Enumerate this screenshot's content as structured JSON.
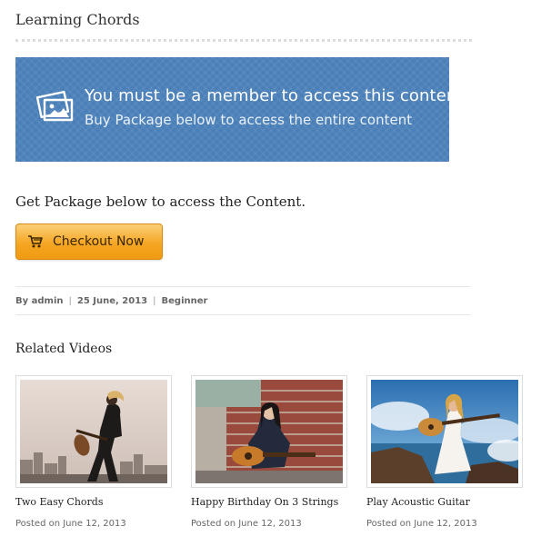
{
  "page": {
    "title": "Learning Chords"
  },
  "notice": {
    "icon": "photo-icon",
    "line1": "You must be a member to access this content.",
    "line2": "Buy Package below to access the entire content",
    "bg_color": "#4a7fb8"
  },
  "cta": {
    "heading": "Get Package below to access the Content.",
    "button_label": "Checkout Now",
    "button_icon": "cart-icon",
    "button_color": "#f5a623"
  },
  "meta": {
    "author_prefix": "By",
    "author": "admin",
    "date": "25 June, 2013",
    "category": "Beginner",
    "separator": "|"
  },
  "related": {
    "heading": "Related Videos",
    "videos": [
      {
        "title": "Two Easy Chords",
        "date": "Posted on June 12, 2013"
      },
      {
        "title": "Happy Birthday On 3 Strings",
        "date": "Posted on June 12, 2013"
      },
      {
        "title": "Play Acoustic Guitar",
        "date": "Posted on June 12, 2013"
      }
    ]
  }
}
